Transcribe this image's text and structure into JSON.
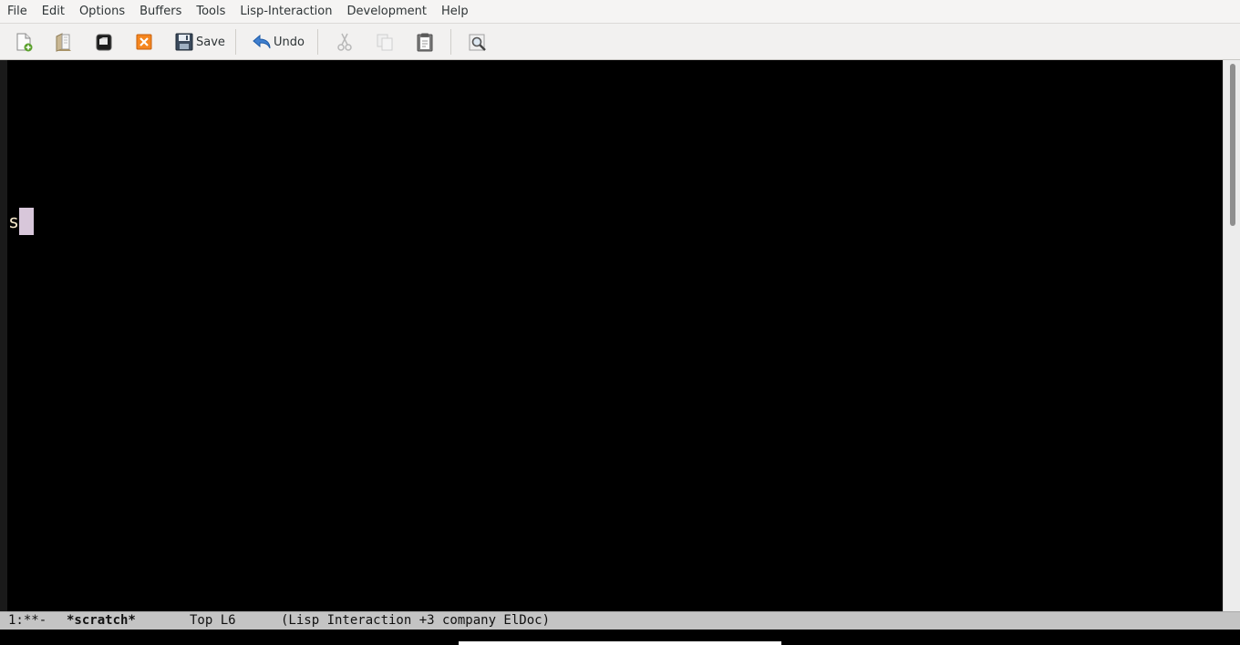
{
  "menubar": {
    "items": [
      "File",
      "Edit",
      "Options",
      "Buffers",
      "Tools",
      "Lisp-Interaction",
      "Development",
      "Help"
    ]
  },
  "toolbar": {
    "new_file_icon": "new-file-icon",
    "open_folder_icon": "open-folder-icon",
    "dired_icon": "dired-icon",
    "kill_buffer_icon": "close-buffer-icon",
    "save_label": "Save",
    "undo_label": "Undo",
    "cut_icon": "cut-icon",
    "copy_icon": "copy-icon",
    "paste_icon": "paste-icon",
    "search_icon": "search-icon"
  },
  "editor": {
    "text": "s",
    "foreground": "#f3e6c8",
    "background": "#000000",
    "cursor_color": "#d8c7da"
  },
  "modeline": {
    "state": "1:**-",
    "buffer_name": "*scratch*",
    "position": "Top L6",
    "modes": "(Lisp Interaction +3 company ElDoc)"
  }
}
